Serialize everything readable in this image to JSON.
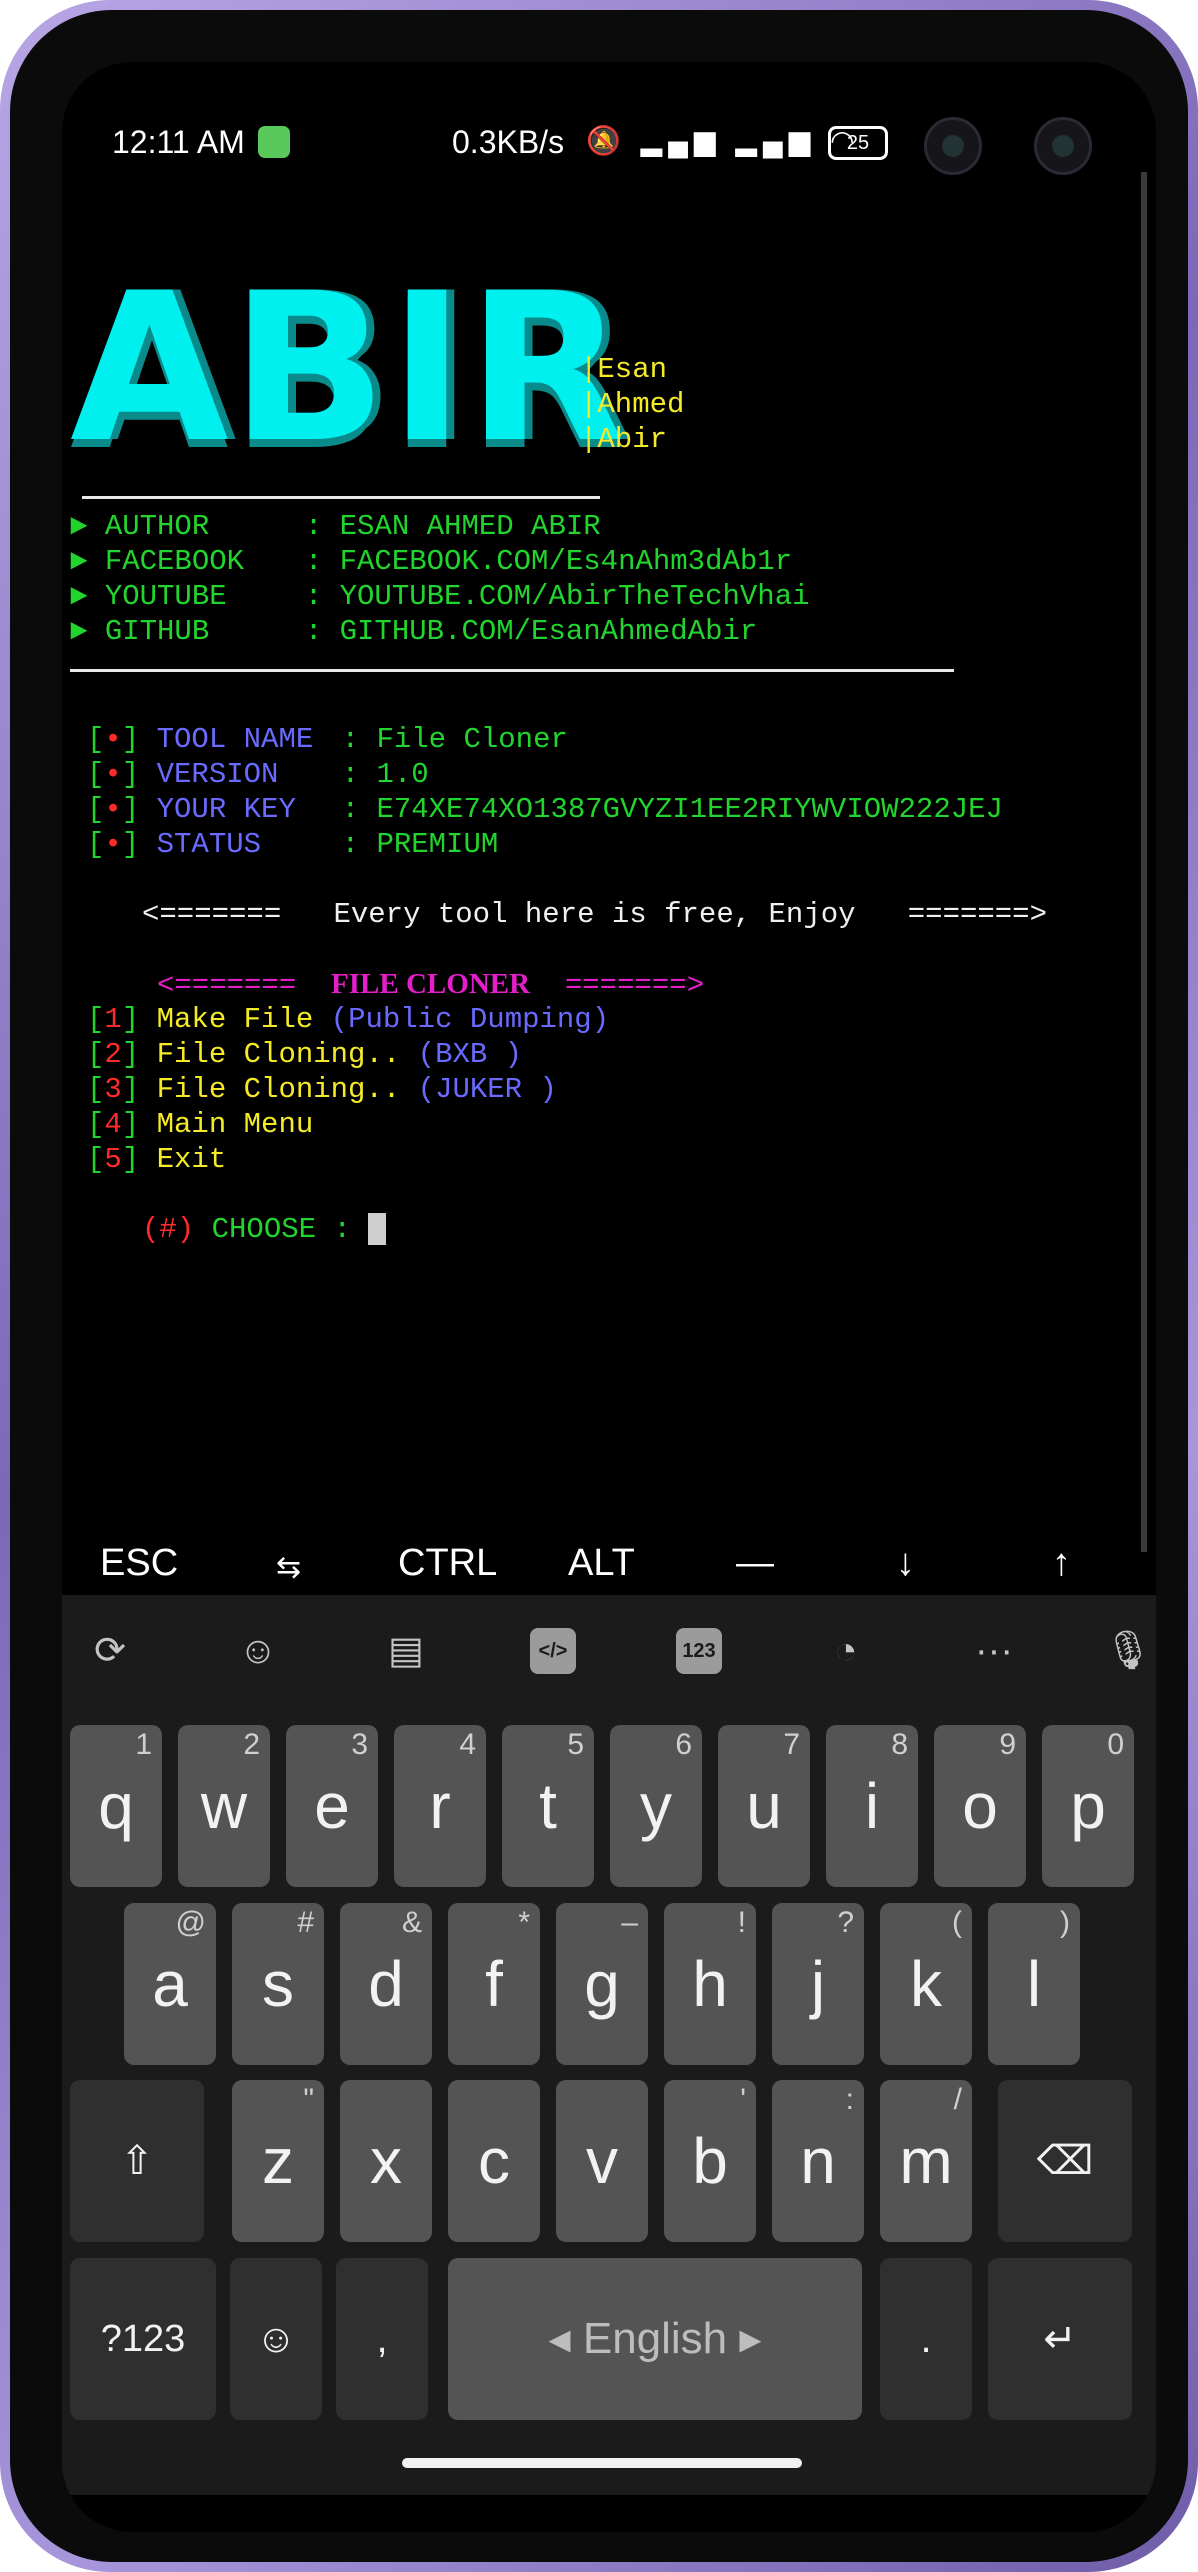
{
  "status_bar": {
    "time": "12:11 AM",
    "net_speed": "0.3KB/s",
    "battery": "25"
  },
  "terminal": {
    "banner_big": "ABIR",
    "banner_side": [
      "|Esan",
      "|Ahmed",
      "|Abir"
    ],
    "info": [
      {
        "label": "AUTHOR",
        "value": "ESAN AHMED ABIR"
      },
      {
        "label": "FACEBOOK",
        "value": "FACEBOOK.COM/Es4nAhm3dAb1r"
      },
      {
        "label": "YOUTUBE",
        "value": "YOUTUBE.COM/AbirTheTechVhai"
      },
      {
        "label": "GITHUB",
        "value": "GITHUB.COM/EsanAhmedAbir"
      }
    ],
    "info_arrow": "►",
    "info_sep": ":",
    "tool_info": [
      {
        "label": "TOOL NAME",
        "value": "File Cloner"
      },
      {
        "label": "VERSION",
        "value": "1.0"
      },
      {
        "label": "YOUR KEY",
        "value": "E74XE74XO1387GVYZI1EE2RIYWVIOW222JEJ"
      },
      {
        "label": "STATUS",
        "value": "PREMIUM"
      }
    ],
    "bullet": "•",
    "free_arrow_left": "<=======",
    "free_text": "Every tool here is free, Enjoy",
    "free_arrow_right": "=======>",
    "menu_title_left": "<=======",
    "menu_title": "FILE CLONER",
    "menu_title_right": "=======>",
    "menu": [
      {
        "num": "1",
        "label": "Make File",
        "note": "(Public Dumping)"
      },
      {
        "num": "2",
        "label": "File Cloning..",
        "note": "(BXB )"
      },
      {
        "num": "3",
        "label": "File Cloning..",
        "note": "(JUKER )"
      },
      {
        "num": "4",
        "label": "Main Menu",
        "note": ""
      },
      {
        "num": "5",
        "label": "Exit",
        "note": ""
      }
    ],
    "prompt_hash": "(#)",
    "prompt_text": "CHOOSE :"
  },
  "extra_keys": {
    "esc": "ESC",
    "tab": "⇆",
    "ctrl": "CTRL",
    "alt": "ALT",
    "dash": "—",
    "down": "↓",
    "up": "↑"
  },
  "keyboard": {
    "toolbar_icons": [
      "translate-icon",
      "emoji-sticker-icon",
      "clipboard-icon",
      "code-icon",
      "numpad-icon",
      "whatsapp-icon",
      "more-icon",
      "microphone-icon"
    ],
    "numpad_label": "123",
    "more_label": "···",
    "row1": [
      {
        "k": "q",
        "h": "1"
      },
      {
        "k": "w",
        "h": "2"
      },
      {
        "k": "e",
        "h": "3"
      },
      {
        "k": "r",
        "h": "4"
      },
      {
        "k": "t",
        "h": "5"
      },
      {
        "k": "y",
        "h": "6"
      },
      {
        "k": "u",
        "h": "7"
      },
      {
        "k": "i",
        "h": "8"
      },
      {
        "k": "o",
        "h": "9"
      },
      {
        "k": "p",
        "h": "0"
      }
    ],
    "row2": [
      {
        "k": "a",
        "h": "@"
      },
      {
        "k": "s",
        "h": "#"
      },
      {
        "k": "d",
        "h": "&"
      },
      {
        "k": "f",
        "h": "*"
      },
      {
        "k": "g",
        "h": "–"
      },
      {
        "k": "h",
        "h": "!"
      },
      {
        "k": "j",
        "h": "?"
      },
      {
        "k": "k",
        "h": "("
      },
      {
        "k": "l",
        "h": ")"
      }
    ],
    "row3": [
      {
        "k": "z",
        "h": "\""
      },
      {
        "k": "x",
        "h": ""
      },
      {
        "k": "c",
        "h": ""
      },
      {
        "k": "v",
        "h": ""
      },
      {
        "k": "b",
        "h": "'"
      },
      {
        "k": "n",
        "h": ":"
      },
      {
        "k": "m",
        "h": "/"
      }
    ],
    "shift": "⇧",
    "backspace": "⌫",
    "sym": "?123",
    "emoji": "☺",
    "comma": ",",
    "space": "◂ English ▸",
    "period": ".",
    "enter": "↵"
  }
}
